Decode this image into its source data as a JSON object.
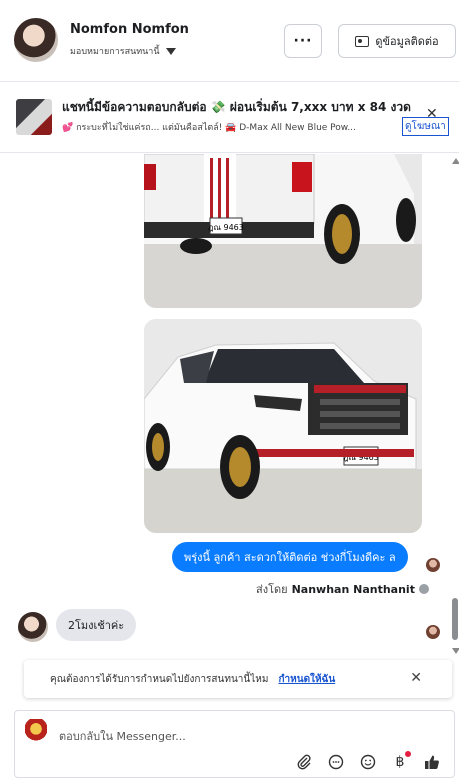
{
  "header": {
    "name": "Nomfon Nomfon",
    "assign_label": "มอบหมายการสนทนานี้",
    "more_label": "···",
    "contact_label": "ดูข้อมูลติดต่อ"
  },
  "ad": {
    "title": "แชทนี้มีข้อความตอบกลับต่อ 💸 ผ่อนเริ่มต้น 7,xxx บาท x 84 งวด",
    "subtitle": "💕 กระบะที่ไม่ใช่แค่รถ... แต่มันคือสไตล์!  🚘  D-Max All New Blue Pow...",
    "link": "ดูโฆษณา",
    "close": "✕"
  },
  "messages": {
    "outgoing_text": "พรุ่งนี้ ลูกค้า สะดวกให้ติดต่อ ช่วงกี่โมงดีคะ  ล",
    "sent_by_prefix": "ส่งโดย",
    "sent_by_name": "Nanwhan Nanthanit",
    "incoming_text": "2โมงเช้าค่ะ",
    "plate_top": "ฎณ 9463",
    "plate_bottom": "ฎณ 9463"
  },
  "notice": {
    "text": "คุณต้องการได้รับการกำหนดไปยังการสนทนานี้ไหม",
    "link": "กำหนดให้ฉัน",
    "close": "✕"
  },
  "composer": {
    "placeholder": "ตอบกลับใน Messenger..."
  },
  "icons": {
    "toolbar": [
      "paperclip-icon",
      "chat-bubble-icon",
      "emoji-icon",
      "baht-icon",
      "thumbs-up-icon"
    ]
  },
  "colors": {
    "accent": "#0a7cff",
    "link": "#1a55d0"
  }
}
